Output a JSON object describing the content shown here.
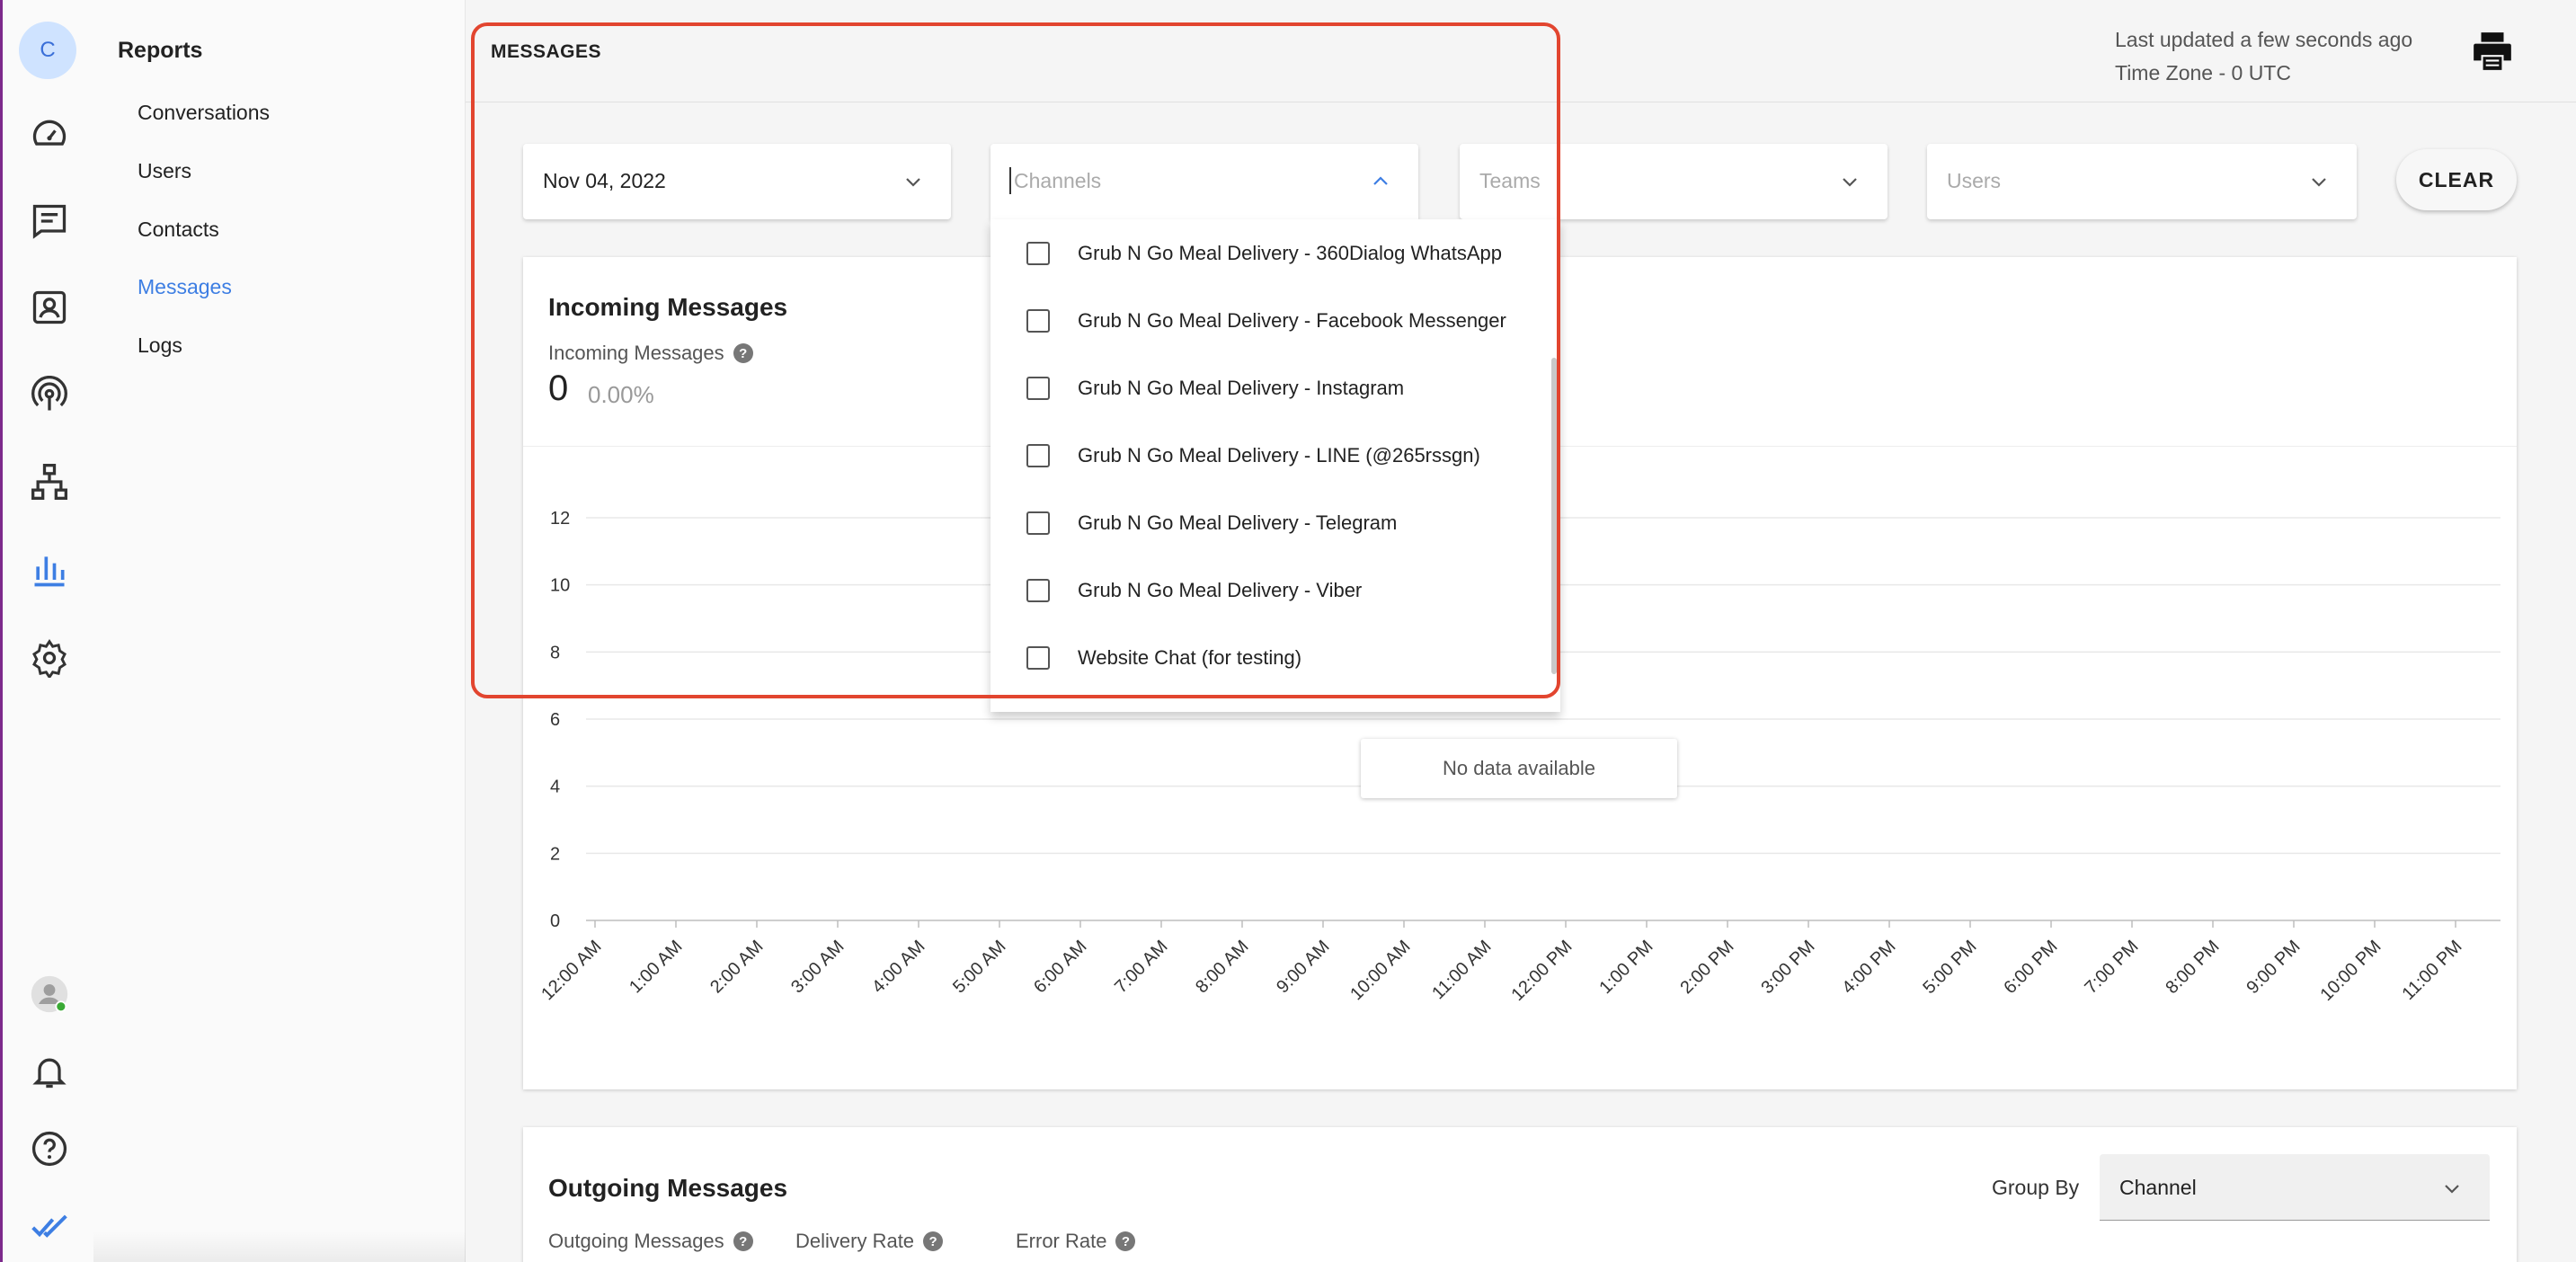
{
  "rail": {
    "avatar_letter": "C",
    "icons": [
      "dashboard-icon",
      "inbox-icon",
      "contacts-icon",
      "broadcast-icon",
      "workflows-icon",
      "reports-icon",
      "settings-icon",
      "user-status-icon",
      "notifications-icon",
      "help-icon",
      "app-logo-icon"
    ],
    "accent": "#3d7ee3"
  },
  "reports_nav": {
    "title": "Reports",
    "items": [
      {
        "label": "Conversations",
        "active": false
      },
      {
        "label": "Users",
        "active": false
      },
      {
        "label": "Contacts",
        "active": false
      },
      {
        "label": "Messages",
        "active": true
      },
      {
        "label": "Logs",
        "active": false
      }
    ]
  },
  "header": {
    "page_title": "MESSAGES",
    "last_updated": "Last updated a few seconds ago",
    "time_zone": "Time Zone - 0 UTC"
  },
  "filters": {
    "date": "Nov 04, 2022",
    "channels_placeholder": "Channels",
    "teams_placeholder": "Teams",
    "users_placeholder": "Users",
    "clear_label": "CLEAR"
  },
  "channels_menu": {
    "options": [
      "Grub N Go Meal Delivery - 360Dialog WhatsApp",
      "Grub N Go Meal Delivery - Facebook Messenger",
      "Grub N Go Meal Delivery - Instagram",
      "Grub N Go Meal Delivery - LINE (@265rssgn)",
      "Grub N Go Meal Delivery - Telegram",
      "Grub N Go Meal Delivery - Viber",
      "Website Chat (for testing)"
    ]
  },
  "incoming": {
    "title": "Incoming Messages",
    "metric_label": "Incoming Messages",
    "value": "0",
    "percent": "0.00%",
    "no_data": "No data available"
  },
  "outgoing": {
    "title": "Outgoing Messages",
    "group_by_label": "Group By",
    "group_by_value": "Channel",
    "metrics": [
      "Outgoing Messages",
      "Delivery Rate",
      "Error Rate"
    ]
  },
  "chart_data": {
    "type": "line",
    "categories": [
      "12:00 AM",
      "1:00 AM",
      "2:00 AM",
      "3:00 AM",
      "4:00 AM",
      "5:00 AM",
      "6:00 AM",
      "7:00 AM",
      "8:00 AM",
      "9:00 AM",
      "10:00 AM",
      "11:00 AM",
      "12:00 PM",
      "1:00 PM",
      "2:00 PM",
      "3:00 PM",
      "4:00 PM",
      "5:00 PM",
      "6:00 PM",
      "7:00 PM",
      "8:00 PM",
      "9:00 PM",
      "10:00 PM",
      "11:00 PM"
    ],
    "yticks": [
      "0",
      "2",
      "4",
      "6",
      "8",
      "10",
      "12"
    ],
    "ylim": [
      0,
      12
    ],
    "series": [],
    "grid": true
  }
}
